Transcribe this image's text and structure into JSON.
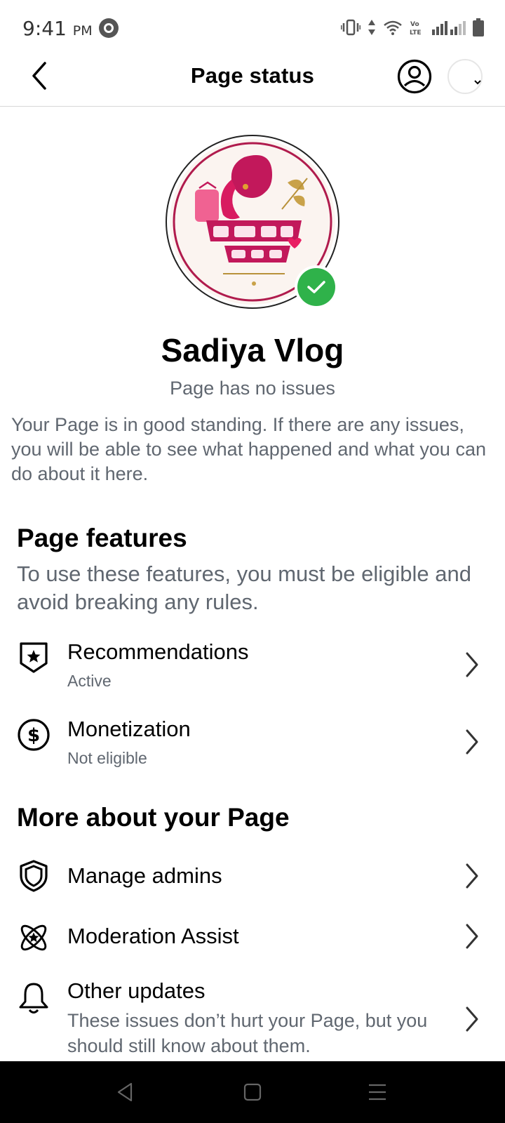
{
  "status_bar": {
    "time": "9:41",
    "ampm": "PM",
    "network_label": "Vo LTE"
  },
  "header": {
    "title": "Page status",
    "back_icon": "chevron-left-icon",
    "profile_icon": "person-circle-icon"
  },
  "page": {
    "name": "Sadiya Vlog",
    "status": "Page has no issues",
    "description": "Your Page is in good standing. If there are any issues, you will be able to see what happened and what you can do about it here.",
    "verified_color": "#2fb24a"
  },
  "page_features": {
    "title": "Page features",
    "subtitle": "To use these features, you must be eligible and avoid breaking any rules.",
    "items": [
      {
        "label": "Recommendations",
        "sublabel": "Active",
        "icon": "shield-star-icon"
      },
      {
        "label": "Monetization",
        "sublabel": "Not eligible",
        "icon": "dollar-circle-icon"
      }
    ]
  },
  "more_about": {
    "title": "More about your Page",
    "items": [
      {
        "label": "Manage admins",
        "icon": "shield-icon"
      },
      {
        "label": "Moderation Assist",
        "icon": "atom-star-icon"
      },
      {
        "label": "Other updates",
        "sublabel": "These issues don’t hurt your Page, but you should still know about them.",
        "icon": "bell-icon"
      }
    ]
  },
  "nav": {
    "back": "triangle-back-icon",
    "home": "square-home-icon",
    "menu": "menu-lines-icon"
  }
}
